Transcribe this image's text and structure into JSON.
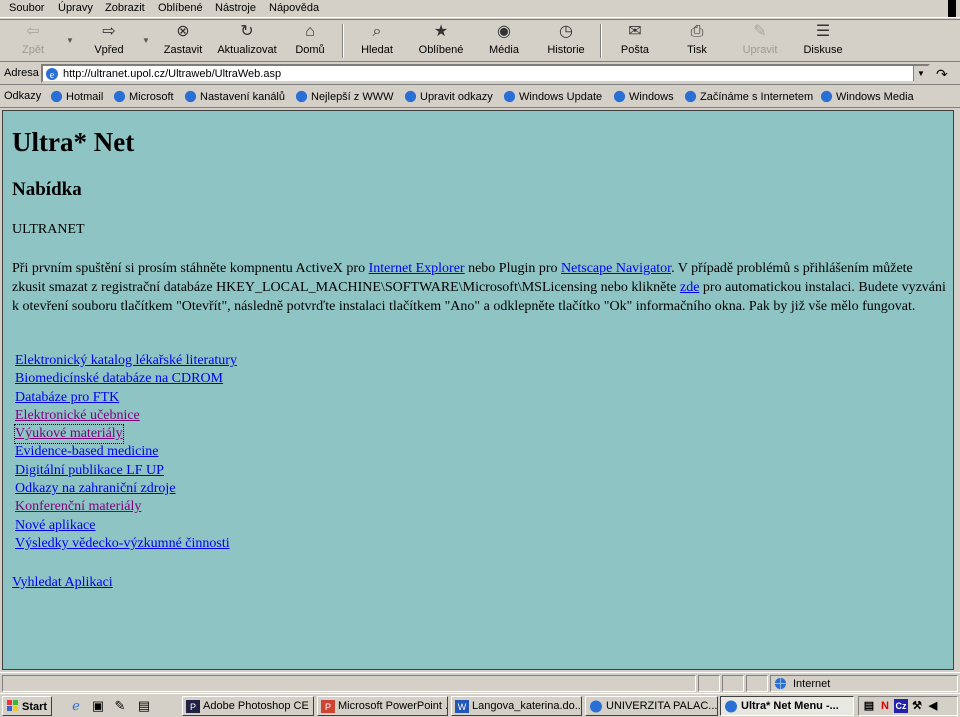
{
  "menu": [
    "Soubor",
    "Úpravy",
    "Zobrazit",
    "Oblíbené",
    "Nástroje",
    "Nápověda"
  ],
  "toolbar": {
    "back": "Zpět",
    "forward": "Vpřed",
    "stop": "Zastavit",
    "refresh": "Aktualizovat",
    "home": "Domů",
    "search": "Hledat",
    "favorites": "Oblíbené",
    "media": "Média",
    "history": "Historie",
    "mail": "Pošta",
    "print": "Tisk",
    "edit": "Upravit",
    "discuss": "Diskuse"
  },
  "address": {
    "label": "Adresa",
    "url": "http://ultranet.upol.cz/Ultraweb/UltraWeb.asp"
  },
  "links": {
    "label": "Odkazy",
    "items": [
      "Hotmail",
      "Microsoft",
      "Nastavení kanálů",
      "Nejlepší z WWW",
      "Upravit odkazy",
      "Windows Update",
      "Windows",
      "Začínáme s Internetem",
      "Windows Media"
    ]
  },
  "page": {
    "title": "Ultra* Net",
    "subtitle": "Nabídka",
    "section": "ULTRANET",
    "intro_1": "Při prvním spuštění si prosím stáhněte kompnentu ActiveX pro ",
    "intro_link_ie": "Internet Explorer",
    "intro_2": " nebo Plugin pro ",
    "intro_link_ns": "Netscape Navigator",
    "intro_3": ". V případě problémů s přihlášením můžete zkusit smazat z registrační databáze HKEY_LOCAL_MACHINE\\SOFTWARE\\Microsoft\\MSLicensing nebo klikněte ",
    "intro_link_here": "zde",
    "intro_4": " pro automatickou instalaci. Budete vyzváni k otevření souboru tlačítkem \"Otevřít\", následně potvrďte instalaci tlačítkem \"Ano\" a odklepněte tlačítko \"Ok\" informačního okna. Pak by již vše mělo fungovat.",
    "menu_links": [
      "Elektronický katalog lékařské literatury",
      "Biomedicínské databáze na CDROM",
      "Databáze pro FTK",
      "Elektronické učebnice",
      "Výukové materiály",
      "Evidence-based medicine",
      "Digitální publikace LF UP",
      "Odkazy na zahraniční zdroje",
      "Konferenční materiály",
      "Nové aplikace",
      "Výsledky vědecko-výzkumné činnosti"
    ],
    "search_link": "Vyhledat Aplikaci"
  },
  "status": {
    "zone": "Internet"
  },
  "taskbar": {
    "start": "Start",
    "tasks": [
      "Adobe Photoshop CE",
      "Microsoft PowerPoint ...",
      "Langova_katerina.do...",
      "UNIVERZITA PALAC...",
      "Ultra* Net Menu -..."
    ]
  },
  "colors": {
    "page_bg": "#8fc4c4",
    "link": "#0000ee",
    "visited": "#800080",
    "chrome": "#d4d0c8"
  }
}
